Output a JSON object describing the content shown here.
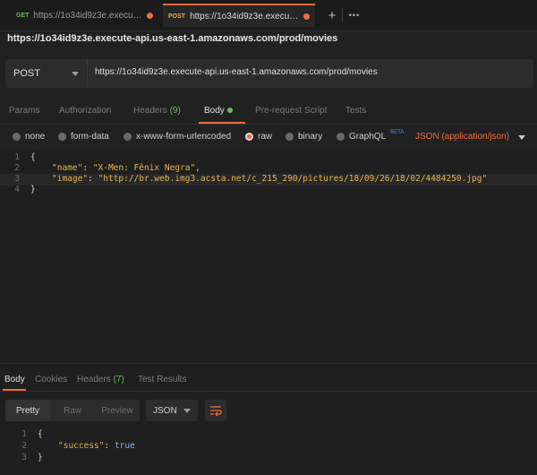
{
  "tabs": [
    {
      "method": "GET",
      "url": "https://1o34id9z3e.execute-api...",
      "unsaved": true
    },
    {
      "method": "POST",
      "url": "https://1o34id9z3e.execute-ap...",
      "unsaved": true
    }
  ],
  "tab_actions": {
    "new_tab": "+",
    "more": "•••"
  },
  "page_url": "https://1o34id9z3e.execute-api.us-east-1.amazonaws.com/prod/movies",
  "request": {
    "method": "POST",
    "url": "https://1o34id9z3e.execute-api.us-east-1.amazonaws.com/prod/movies"
  },
  "request_tabs": {
    "params": "Params",
    "authorization": "Authorization",
    "headers": "Headers",
    "headers_count": "(9)",
    "body": "Body",
    "prerequest": "Pre-request Script",
    "tests": "Tests"
  },
  "body_types": {
    "none": "none",
    "form_data": "form-data",
    "urlencoded": "x-www-form-urlencoded",
    "raw": "raw",
    "binary": "binary",
    "graphql": "GraphQL",
    "graphql_badge": "BETA",
    "selected": "raw",
    "content_type": "JSON (application/json)"
  },
  "editor": {
    "line_numbers": [
      "1",
      "2",
      "3",
      "4"
    ],
    "open_brace": "{",
    "close_brace": "}",
    "name_key": "\"name\"",
    "name_value": "\"X-Men: Fênix Negra\"",
    "image_key": "\"image\"",
    "image_value": "\"http://br.web.img3.acsta.net/c_215_290/pictures/18/09/26/18/02/4484250.jpg\""
  },
  "response_tabs": {
    "body": "Body",
    "cookies": "Cookies",
    "headers": "Headers",
    "headers_count": "(7)",
    "test_results": "Test Results"
  },
  "response_view": {
    "pretty": "Pretty",
    "raw": "Raw",
    "preview": "Preview",
    "format": "JSON"
  },
  "response_body": {
    "line_numbers": [
      "1",
      "2",
      "3"
    ],
    "open_brace": "{",
    "close_brace": "}",
    "key": "\"success\"",
    "value": "true"
  },
  "colors": {
    "accent": "#f26b3a",
    "get": "#6bbd5b",
    "post": "#ecb03a"
  }
}
